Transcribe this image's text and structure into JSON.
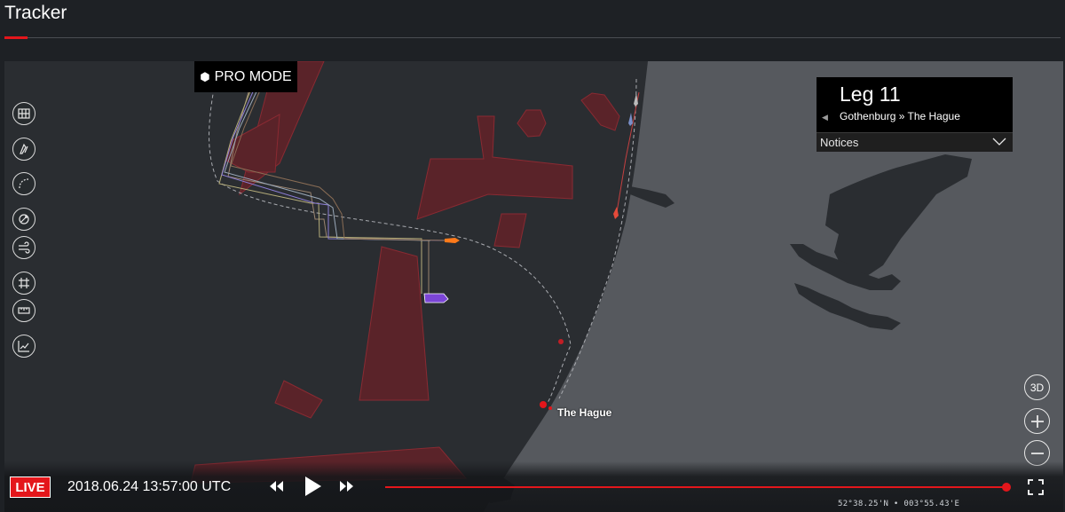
{
  "header": {
    "title": "Tracker"
  },
  "map": {
    "pro_mode_label": "PRO MODE",
    "city_label": "The Hague",
    "toolbar": [
      {
        "name": "map-layers-icon"
      },
      {
        "name": "boats-icon"
      },
      {
        "name": "course-icon"
      },
      {
        "name": "wind-icon"
      },
      {
        "name": "current-icon"
      },
      {
        "name": "grid-icon"
      },
      {
        "name": "ruler-icon"
      },
      {
        "name": "chart-icon"
      }
    ],
    "coordinates": "52°38.25'N • 003°55.43'E"
  },
  "leg_panel": {
    "title": "Leg 11",
    "route": "Gothenburg » The Hague",
    "notices_label": "Notices"
  },
  "zoom": {
    "three_d_label": "3D"
  },
  "playback": {
    "live_label": "LIVE",
    "timestamp": "2018.06.24 13:57:00 UTC",
    "progress": 1.0
  },
  "colors": {
    "accent": "#e4161b",
    "sea": "#2a2d31",
    "land": "#5a5d62",
    "restricted_zone": "#6e2329"
  }
}
